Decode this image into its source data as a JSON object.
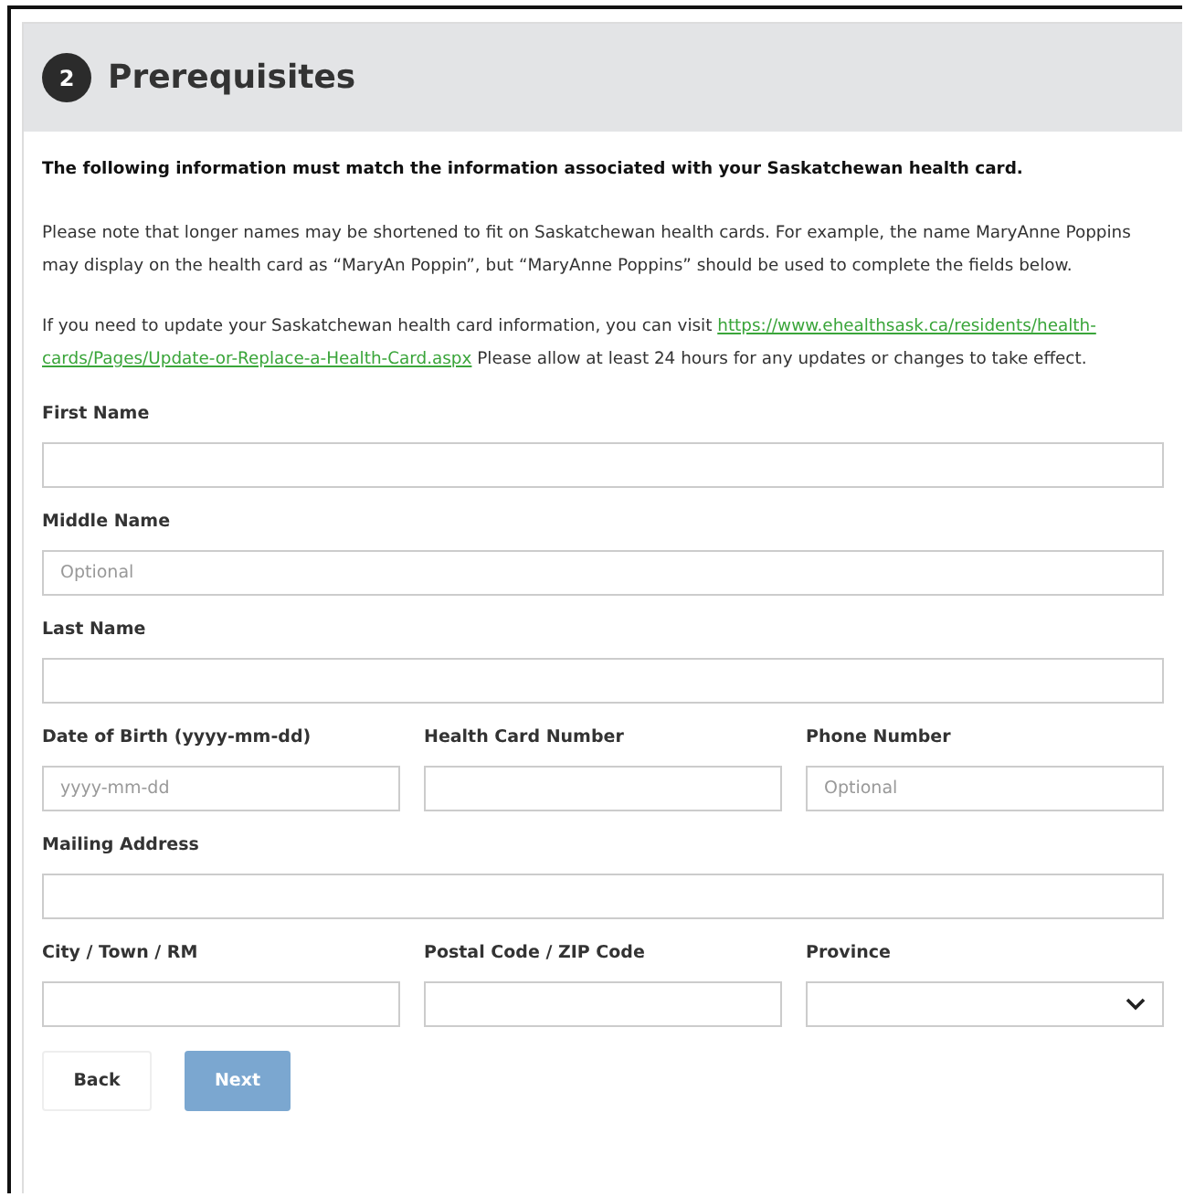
{
  "header": {
    "step": "2",
    "title": "Prerequisites"
  },
  "paragraphs": [
    {
      "kind": "bold",
      "text": "The following information must match the information associated with your Saskatchewan health card."
    },
    {
      "kind": "plain",
      "text": "Please note that longer names may be shortened to fit on Saskatchewan health cards. For example, the name MaryAnne Poppins may display on the health card as “MaryAn Poppin”, but “MaryAnne Poppins” should be used to complete the fields below."
    },
    {
      "kind": "link",
      "text": "If you need to update your Saskatchewan health card information, you can visit",
      "link_lines": [
        "https://www.ehealthsask.ca/residents/health-",
        "cards/Pages/Update-or-Replace-a-Health-Card.aspx"
      ],
      "after": "Please allow at least 24 hours for any updates or changes to take effect."
    }
  ],
  "field_rows": [
    [
      {
        "label": "First Name",
        "kind": "text"
      }
    ],
    [
      {
        "label": "Middle Name",
        "kind": "text",
        "placeholder": "Optional"
      }
    ],
    [
      {
        "label": "Last Name",
        "kind": "text"
      }
    ],
    [
      {
        "label": "Date of Birth (yyyy-mm-dd)",
        "kind": "text",
        "placeholder": "yyyy-mm-dd"
      },
      {
        "label": "Health Card Number",
        "kind": "text"
      },
      {
        "label": "Phone Number",
        "kind": "text",
        "placeholder": "Optional"
      }
    ],
    [
      {
        "label": "Mailing Address",
        "kind": "text"
      }
    ],
    [
      {
        "label": "City / Town / RM",
        "kind": "text"
      },
      {
        "label": "Postal Code / ZIP Code",
        "kind": "text"
      },
      {
        "label": "Province",
        "kind": "select"
      }
    ]
  ],
  "buttons": [
    {
      "label": "Back",
      "kind": "secondary",
      "disabled": false
    },
    {
      "label": "Next",
      "kind": "primary",
      "disabled": true
    }
  ]
}
